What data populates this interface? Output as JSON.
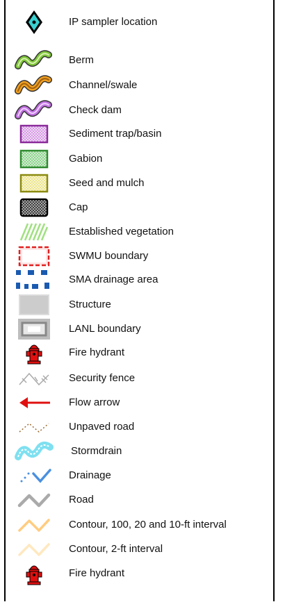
{
  "legend": {
    "items": [
      {
        "key": "ip-sampler",
        "label": "IP sampler location",
        "icon": "ip-sampler-diamond-icon"
      },
      {
        "key": "berm",
        "label": "Berm",
        "icon": "berm-zigzag-icon",
        "color": "#7ec63a"
      },
      {
        "key": "channel",
        "label": "Channel/swale",
        "icon": "channel-zigzag-icon",
        "color": "#f0a020"
      },
      {
        "key": "check-dam",
        "label": "Check dam",
        "icon": "check-dam-zigzag-icon",
        "color": "#c070e0"
      },
      {
        "key": "sediment-trap",
        "label": "Sediment trap/basin",
        "icon": "sediment-trap-box-icon",
        "color": "#8a2a9a"
      },
      {
        "key": "gabion",
        "label": "Gabion",
        "icon": "gabion-box-icon",
        "color": "#2e8a2e"
      },
      {
        "key": "seed-mulch",
        "label": "Seed and mulch",
        "icon": "seed-mulch-box-icon",
        "color": "#8a8a10"
      },
      {
        "key": "cap",
        "label": "Cap",
        "icon": "cap-box-icon",
        "color": "#000000"
      },
      {
        "key": "established-veg",
        "label": "Established vegetation",
        "icon": "vegetation-hatch-icon",
        "color": "#a0e080"
      },
      {
        "key": "swmu",
        "label": "SWMU boundary",
        "icon": "swmu-boundary-icon",
        "color": "#e02020"
      },
      {
        "key": "sma-drainage",
        "label": "SMA drainage area",
        "icon": "sma-drainage-icon",
        "color": "#1a5ab0"
      },
      {
        "key": "structure",
        "label": "Structure",
        "icon": "structure-box-icon",
        "color": "#cccccc"
      },
      {
        "key": "lanl",
        "label": "LANL boundary",
        "icon": "lanl-boundary-icon",
        "color": "#999999"
      },
      {
        "key": "hydrant-1",
        "label": "Fire hydrant",
        "icon": "fire-hydrant-icon",
        "color": "#e01010"
      },
      {
        "key": "security-fence",
        "label": "Security fence",
        "icon": "security-fence-icon",
        "color": "#aaaaaa"
      },
      {
        "key": "flow-arrow",
        "label": "Flow arrow",
        "icon": "flow-arrow-icon",
        "color": "#e01010"
      },
      {
        "key": "unpaved-road",
        "label": "Unpaved road",
        "icon": "unpaved-road-icon",
        "color": "#9a6a30"
      },
      {
        "key": "stormdrain",
        "label": "Stormdrain",
        "icon": "stormdrain-icon",
        "color": "#7ee0f0"
      },
      {
        "key": "drainage",
        "label": "Drainage",
        "icon": "drainage-icon",
        "color": "#4a90e0"
      },
      {
        "key": "road",
        "label": "Road",
        "icon": "road-icon",
        "color": "#aaaaaa"
      },
      {
        "key": "contour-major",
        "label": "Contour, 100, 20 and 10-ft interval",
        "icon": "contour-major-icon",
        "color": "#ffcc80"
      },
      {
        "key": "contour-minor",
        "label": "Contour, 2-ft interval",
        "icon": "contour-minor-icon",
        "color": "#ffe8c0"
      },
      {
        "key": "hydrant-2",
        "label": "Fire hydrant",
        "icon": "fire-hydrant-icon",
        "color": "#e01010"
      }
    ]
  }
}
